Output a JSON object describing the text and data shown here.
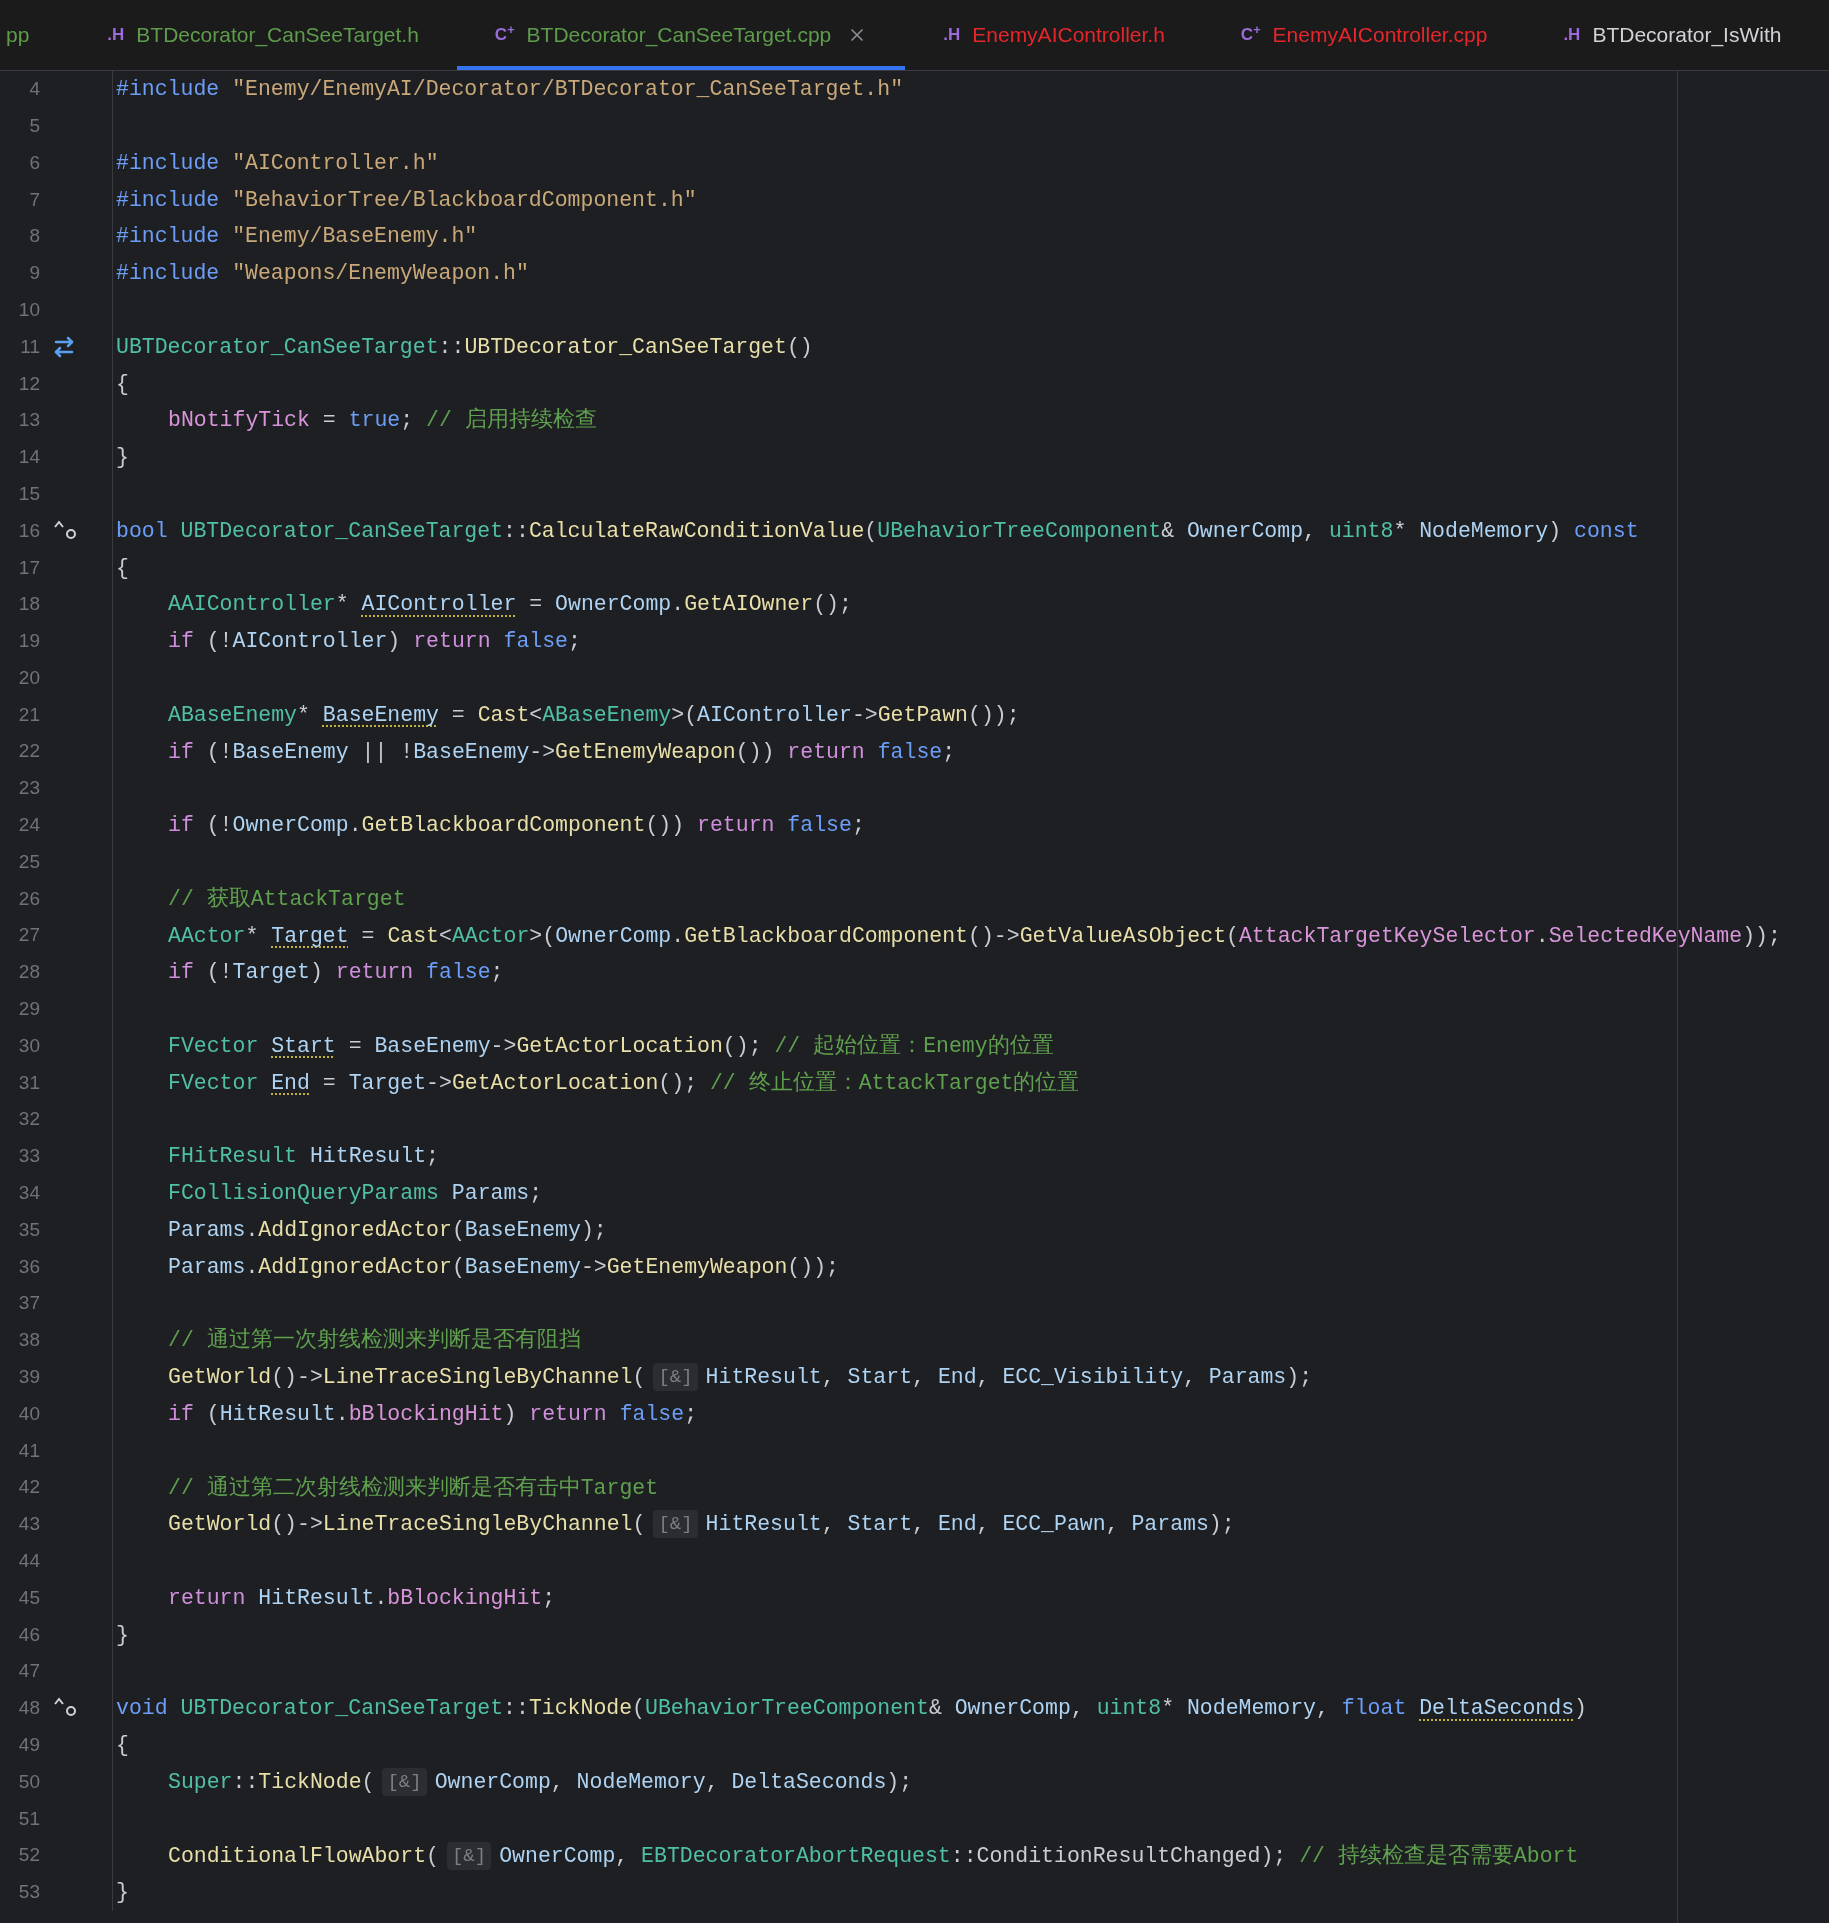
{
  "tabs": [
    {
      "label": "pp",
      "color": "#5e9c4c",
      "selected": false
    },
    {
      "label": "BTDecorator_CanSeeTarget.h",
      "icon": ".H",
      "color": "#5e9c4c",
      "selected": false
    },
    {
      "label": "BTDecorator_CanSeeTarget.cpp",
      "icon": "C$^{+}$",
      "color": "#5e9c4c",
      "selected": true
    },
    {
      "label": "EnemyAIController.h",
      "icon": ".H",
      "color": "#e5262b",
      "selected": false
    },
    {
      "label": "EnemyAIController.cpp",
      "icon": "C$^{+}$",
      "color": "#e5262b",
      "selected": false
    },
    {
      "label": "BTDecorator_IsWith",
      "icon": ".H",
      "color": "#d0d2d6",
      "selected": false
    }
  ],
  "lines": [
    {
      "number": "4",
      "tokens": [
        {
          "text": "#include ",
          "kind": "kw"
        },
        {
          "text": "\"Enemy/EnemyAI/Decorator/BTDecorator_CanSeeTarget.h\"",
          "kind": "str"
        }
      ]
    },
    {
      "number": "5"
    },
    {
      "number": "6",
      "tokens": [
        {
          "text": "#include ",
          "kind": "kw"
        },
        {
          "text": "\"AIController.h\"",
          "kind": "str"
        }
      ]
    },
    {
      "number": "7",
      "tokens": [
        {
          "text": "#include ",
          "kind": "kw"
        },
        {
          "text": "\"BehaviorTree/BlackboardComponent.h\"",
          "kind": "str"
        }
      ]
    },
    {
      "number": "8",
      "tokens": [
        {
          "text": "#include ",
          "kind": "kw"
        },
        {
          "text": "\"Enemy/BaseEnemy.h\"",
          "kind": "str"
        }
      ]
    },
    {
      "number": "9",
      "tokens": [
        {
          "text": "#include ",
          "kind": "kw"
        },
        {
          "text": "\"Weapons/EnemyWeapon.h\"",
          "kind": "str"
        }
      ]
    },
    {
      "number": "10"
    },
    {
      "number": "11",
      "kind": "swap",
      "tokens": [
        {
          "text": "UBTDecorator_CanSeeTarget",
          "kind": "type"
        },
        {
          "text": "::",
          "kind": "p"
        },
        {
          "text": "UBTDecorator_CanSeeTarget",
          "kind": "fn"
        },
        {
          "text": "()",
          "kind": "p"
        }
      ]
    },
    {
      "number": "12",
      "tokens": [
        {
          "text": "{",
          "kind": "p"
        }
      ]
    },
    {
      "number": "13",
      "indented": true,
      "tokens": [
        {
          "text": "bNotifyTick",
          "kind": "field"
        },
        {
          "text": " = ",
          "kind": "p"
        },
        {
          "text": "true",
          "kind": "kw"
        },
        {
          "text": "; ",
          "kind": "p"
        },
        {
          "text": "// 启用持续检查",
          "kind": "cmt"
        }
      ]
    },
    {
      "number": "14",
      "tokens": [
        {
          "text": "}",
          "kind": "p"
        }
      ]
    },
    {
      "number": "15"
    },
    {
      "number": "16",
      "kind": "override",
      "tokens": [
        {
          "text": "bool ",
          "kind": "kw"
        },
        {
          "text": "UBTDecorator_CanSeeTarget",
          "kind": "type"
        },
        {
          "text": "::",
          "kind": "p"
        },
        {
          "text": "CalculateRawConditionValue",
          "kind": "fn"
        },
        {
          "text": "(",
          "kind": "p"
        },
        {
          "text": "UBehaviorTreeComponent",
          "kind": "type"
        },
        {
          "text": "& ",
          "kind": "p"
        },
        {
          "text": "OwnerComp",
          "kind": "var"
        },
        {
          "text": ", ",
          "kind": "p"
        },
        {
          "text": "uint8",
          "kind": "type"
        },
        {
          "text": "* ",
          "kind": "p"
        },
        {
          "text": "NodeMemory",
          "kind": "var"
        },
        {
          "text": ") ",
          "kind": "p"
        },
        {
          "text": "const",
          "kind": "kw"
        }
      ]
    },
    {
      "number": "17",
      "tokens": [
        {
          "text": "{",
          "kind": "p"
        }
      ]
    },
    {
      "number": "18",
      "indented": true,
      "tokens": [
        {
          "text": "AAIController",
          "kind": "type"
        },
        {
          "text": "* ",
          "kind": "p"
        },
        {
          "text": "AIController",
          "kind": "var",
          "warned": true
        },
        {
          "text": " = ",
          "kind": "p"
        },
        {
          "text": "OwnerComp",
          "kind": "var"
        },
        {
          "text": ".",
          "kind": "p"
        },
        {
          "text": "GetAIOwner",
          "kind": "fn"
        },
        {
          "text": "();",
          "kind": "p"
        }
      ]
    },
    {
      "number": "19",
      "indented": true,
      "tokens": [
        {
          "text": "if ",
          "kind": "ctrl"
        },
        {
          "text": "(!",
          "kind": "p"
        },
        {
          "text": "AIController",
          "kind": "var"
        },
        {
          "text": ") ",
          "kind": "p"
        },
        {
          "text": "return ",
          "kind": "ctrl"
        },
        {
          "text": "false",
          "kind": "kw"
        },
        {
          "text": ";",
          "kind": "p"
        }
      ]
    },
    {
      "number": "20"
    },
    {
      "number": "21",
      "indented": true,
      "tokens": [
        {
          "text": "ABaseEnemy",
          "kind": "type"
        },
        {
          "text": "* ",
          "kind": "p"
        },
        {
          "text": "BaseEnemy",
          "kind": "var",
          "warned": true
        },
        {
          "text": " = ",
          "kind": "p"
        },
        {
          "text": "Cast",
          "kind": "fn"
        },
        {
          "text": "<",
          "kind": "p"
        },
        {
          "text": "ABaseEnemy",
          "kind": "type"
        },
        {
          "text": ">(",
          "kind": "p"
        },
        {
          "text": "AIController",
          "kind": "var"
        },
        {
          "text": "->",
          "kind": "p"
        },
        {
          "text": "GetPawn",
          "kind": "fn"
        },
        {
          "text": "());",
          "kind": "p"
        }
      ]
    },
    {
      "number": "22",
      "indented": true,
      "tokens": [
        {
          "text": "if ",
          "kind": "ctrl"
        },
        {
          "text": "(!",
          "kind": "p"
        },
        {
          "text": "BaseEnemy",
          "kind": "var"
        },
        {
          "text": " || !",
          "kind": "p"
        },
        {
          "text": "BaseEnemy",
          "kind": "var"
        },
        {
          "text": "->",
          "kind": "p"
        },
        {
          "text": "GetEnemyWeapon",
          "kind": "fn"
        },
        {
          "text": "()) ",
          "kind": "p"
        },
        {
          "text": "return ",
          "kind": "ctrl"
        },
        {
          "text": "false",
          "kind": "kw"
        },
        {
          "text": ";",
          "kind": "p"
        }
      ]
    },
    {
      "number": "23"
    },
    {
      "number": "24",
      "indented": true,
      "tokens": [
        {
          "text": "if ",
          "kind": "ctrl"
        },
        {
          "text": "(!",
          "kind": "p"
        },
        {
          "text": "OwnerComp",
          "kind": "var"
        },
        {
          "text": ".",
          "kind": "p"
        },
        {
          "text": "GetBlackboardComponent",
          "kind": "fn"
        },
        {
          "text": "()) ",
          "kind": "p"
        },
        {
          "text": "return ",
          "kind": "ctrl"
        },
        {
          "text": "false",
          "kind": "kw"
        },
        {
          "text": ";",
          "kind": "p"
        }
      ]
    },
    {
      "number": "25"
    },
    {
      "number": "26",
      "indented": true,
      "tokens": [
        {
          "text": "// 获取AttackTarget",
          "kind": "cmt"
        }
      ]
    },
    {
      "number": "27",
      "indented": true,
      "tokens": [
        {
          "text": "AActor",
          "kind": "type"
        },
        {
          "text": "* ",
          "kind": "p"
        },
        {
          "text": "Target",
          "kind": "var",
          "warned": true
        },
        {
          "text": " = ",
          "kind": "p"
        },
        {
          "text": "Cast",
          "kind": "fn"
        },
        {
          "text": "<",
          "kind": "p"
        },
        {
          "text": "AActor",
          "kind": "type"
        },
        {
          "text": ">(",
          "kind": "p"
        },
        {
          "text": "OwnerComp",
          "kind": "var"
        },
        {
          "text": ".",
          "kind": "p"
        },
        {
          "text": "GetBlackboardComponent",
          "kind": "fn"
        },
        {
          "text": "()->",
          "kind": "p"
        },
        {
          "text": "GetValueAsObject",
          "kind": "fn"
        },
        {
          "text": "(",
          "kind": "p"
        },
        {
          "text": "AttackTargetKeySelector",
          "kind": "field"
        },
        {
          "text": ".",
          "kind": "p"
        },
        {
          "text": "SelectedKeyName",
          "kind": "field"
        },
        {
          "text": "));",
          "kind": "p"
        }
      ]
    },
    {
      "number": "28",
      "indented": true,
      "tokens": [
        {
          "text": "if ",
          "kind": "ctrl"
        },
        {
          "text": "(!",
          "kind": "p"
        },
        {
          "text": "Target",
          "kind": "var"
        },
        {
          "text": ") ",
          "kind": "p"
        },
        {
          "text": "return ",
          "kind": "ctrl"
        },
        {
          "text": "false",
          "kind": "kw"
        },
        {
          "text": ";",
          "kind": "p"
        }
      ]
    },
    {
      "number": "29"
    },
    {
      "number": "30",
      "indented": true,
      "tokens": [
        {
          "text": "FVector ",
          "kind": "type"
        },
        {
          "text": "Start",
          "kind": "var",
          "warned": true
        },
        {
          "text": " = ",
          "kind": "p"
        },
        {
          "text": "BaseEnemy",
          "kind": "var"
        },
        {
          "text": "->",
          "kind": "p"
        },
        {
          "text": "GetActorLocation",
          "kind": "fn"
        },
        {
          "text": "(); ",
          "kind": "p"
        },
        {
          "text": "// 起始位置：Enemy的位置",
          "kind": "cmt"
        }
      ]
    },
    {
      "number": "31",
      "indented": true,
      "tokens": [
        {
          "text": "FVector ",
          "kind": "type"
        },
        {
          "text": "End",
          "kind": "var",
          "warned": true
        },
        {
          "text": " = ",
          "kind": "p"
        },
        {
          "text": "Target",
          "kind": "var"
        },
        {
          "text": "->",
          "kind": "p"
        },
        {
          "text": "GetActorLocation",
          "kind": "fn"
        },
        {
          "text": "(); ",
          "kind": "p"
        },
        {
          "text": "// 终止位置：AttackTarget的位置",
          "kind": "cmt"
        }
      ]
    },
    {
      "number": "32"
    },
    {
      "number": "33",
      "indented": true,
      "tokens": [
        {
          "text": "FHitResult ",
          "kind": "type"
        },
        {
          "text": "HitResult",
          "kind": "var"
        },
        {
          "text": ";",
          "kind": "p"
        }
      ]
    },
    {
      "number": "34",
      "indented": true,
      "tokens": [
        {
          "text": "FCollisionQueryParams ",
          "kind": "type"
        },
        {
          "text": "Params",
          "kind": "var"
        },
        {
          "text": ";",
          "kind": "p"
        }
      ]
    },
    {
      "number": "35",
      "indented": true,
      "tokens": [
        {
          "text": "Params",
          "kind": "var"
        },
        {
          "text": ".",
          "kind": "p"
        },
        {
          "text": "AddIgnoredActor",
          "kind": "fn"
        },
        {
          "text": "(",
          "kind": "p"
        },
        {
          "text": "BaseEnemy",
          "kind": "var"
        },
        {
          "text": ");",
          "kind": "p"
        }
      ]
    },
    {
      "number": "36",
      "indented": true,
      "tokens": [
        {
          "text": "Params",
          "kind": "var"
        },
        {
          "text": ".",
          "kind": "p"
        },
        {
          "text": "AddIgnoredActor",
          "kind": "fn"
        },
        {
          "text": "(",
          "kind": "p"
        },
        {
          "text": "BaseEnemy",
          "kind": "var"
        },
        {
          "text": "->",
          "kind": "p"
        },
        {
          "text": "GetEnemyWeapon",
          "kind": "fn"
        },
        {
          "text": "());",
          "kind": "p"
        }
      ]
    },
    {
      "number": "37"
    },
    {
      "number": "38",
      "indented": true,
      "tokens": [
        {
          "text": "// 通过第一次射线检测来判断是否有阻挡",
          "kind": "cmt"
        }
      ]
    },
    {
      "number": "39",
      "indented": true,
      "tokens": [
        {
          "text": "GetWorld",
          "kind": "fn"
        },
        {
          "text": "()->",
          "kind": "p"
        },
        {
          "text": "LineTraceSingleByChannel",
          "kind": "fn"
        },
        {
          "text": "(",
          "kind": "p"
        },
        {
          "text": "[&]",
          "kind": "hint"
        },
        {
          "text": "HitResult",
          "kind": "var"
        },
        {
          "text": ", ",
          "kind": "p"
        },
        {
          "text": "Start",
          "kind": "var"
        },
        {
          "text": ", ",
          "kind": "p"
        },
        {
          "text": "End",
          "kind": "var"
        },
        {
          "text": ", ",
          "kind": "p"
        },
        {
          "text": "ECC_Visibility",
          "kind": "var"
        },
        {
          "text": ", ",
          "kind": "p"
        },
        {
          "text": "Params",
          "kind": "var"
        },
        {
          "text": ");",
          "kind": "p"
        }
      ]
    },
    {
      "number": "40",
      "indented": true,
      "tokens": [
        {
          "text": "if ",
          "kind": "ctrl"
        },
        {
          "text": "(",
          "kind": "p"
        },
        {
          "text": "HitResult",
          "kind": "var"
        },
        {
          "text": ".",
          "kind": "p"
        },
        {
          "text": "bBlockingHit",
          "kind": "field"
        },
        {
          "text": ") ",
          "kind": "p"
        },
        {
          "text": "return ",
          "kind": "ctrl"
        },
        {
          "text": "false",
          "kind": "kw"
        },
        {
          "text": ";",
          "kind": "p"
        }
      ]
    },
    {
      "number": "41"
    },
    {
      "number": "42",
      "indented": true,
      "tokens": [
        {
          "text": "// 通过第二次射线检测来判断是否有击中Target",
          "kind": "cmt"
        }
      ]
    },
    {
      "number": "43",
      "indented": true,
      "tokens": [
        {
          "text": "GetWorld",
          "kind": "fn"
        },
        {
          "text": "()->",
          "kind": "p"
        },
        {
          "text": "LineTraceSingleByChannel",
          "kind": "fn"
        },
        {
          "text": "(",
          "kind": "p"
        },
        {
          "text": "[&]",
          "kind": "hint"
        },
        {
          "text": "HitResult",
          "kind": "var"
        },
        {
          "text": ", ",
          "kind": "p"
        },
        {
          "text": "Start",
          "kind": "var"
        },
        {
          "text": ", ",
          "kind": "p"
        },
        {
          "text": "End",
          "kind": "var"
        },
        {
          "text": ", ",
          "kind": "p"
        },
        {
          "text": "ECC_Pawn",
          "kind": "var"
        },
        {
          "text": ", ",
          "kind": "p"
        },
        {
          "text": "Params",
          "kind": "var"
        },
        {
          "text": ");",
          "kind": "p"
        }
      ]
    },
    {
      "number": "44"
    },
    {
      "number": "45",
      "indented": true,
      "tokens": [
        {
          "text": "return ",
          "kind": "ctrl"
        },
        {
          "text": "HitResult",
          "kind": "var"
        },
        {
          "text": ".",
          "kind": "p"
        },
        {
          "text": "bBlockingHit",
          "kind": "field"
        },
        {
          "text": ";",
          "kind": "p"
        }
      ]
    },
    {
      "number": "46",
      "tokens": [
        {
          "text": "}",
          "kind": "p"
        }
      ]
    },
    {
      "number": "47"
    },
    {
      "number": "48",
      "kind": "override",
      "tokens": [
        {
          "text": "void ",
          "kind": "kw"
        },
        {
          "text": "UBTDecorator_CanSeeTarget",
          "kind": "type"
        },
        {
          "text": "::",
          "kind": "p"
        },
        {
          "text": "TickNode",
          "kind": "fn"
        },
        {
          "text": "(",
          "kind": "p"
        },
        {
          "text": "UBehaviorTreeComponent",
          "kind": "type"
        },
        {
          "text": "& ",
          "kind": "p"
        },
        {
          "text": "OwnerComp",
          "kind": "var"
        },
        {
          "text": ", ",
          "kind": "p"
        },
        {
          "text": "uint8",
          "kind": "type"
        },
        {
          "text": "* ",
          "kind": "p"
        },
        {
          "text": "NodeMemory",
          "kind": "var"
        },
        {
          "text": ", ",
          "kind": "p"
        },
        {
          "text": "float ",
          "kind": "kw"
        },
        {
          "text": "DeltaSeconds",
          "kind": "var",
          "warned": true
        },
        {
          "text": ")",
          "kind": "p"
        }
      ]
    },
    {
      "number": "49",
      "tokens": [
        {
          "text": "{",
          "kind": "p"
        }
      ]
    },
    {
      "number": "50",
      "indented": true,
      "tokens": [
        {
          "text": "Super",
          "kind": "type"
        },
        {
          "text": "::",
          "kind": "p"
        },
        {
          "text": "TickNode",
          "kind": "fn"
        },
        {
          "text": "(",
          "kind": "p"
        },
        {
          "text": "[&]",
          "kind": "hint"
        },
        {
          "text": "OwnerComp",
          "kind": "var"
        },
        {
          "text": ", ",
          "kind": "p"
        },
        {
          "text": "NodeMemory",
          "kind": "var"
        },
        {
          "text": ", ",
          "kind": "p"
        },
        {
          "text": "DeltaSeconds",
          "kind": "var"
        },
        {
          "text": ");",
          "kind": "p"
        }
      ]
    },
    {
      "number": "51"
    },
    {
      "number": "52",
      "indented": true,
      "tokens": [
        {
          "text": "ConditionalFlowAbort",
          "kind": "fn"
        },
        {
          "text": "(",
          "kind": "p"
        },
        {
          "text": "[&]",
          "kind": "hint"
        },
        {
          "text": "OwnerComp",
          "kind": "var"
        },
        {
          "text": ", ",
          "kind": "p"
        },
        {
          "text": "EBTDecoratorAbortRequest",
          "kind": "type"
        },
        {
          "text": "::ConditionResultChanged); ",
          "kind": "p"
        },
        {
          "text": "// 持续检查是否需要Abort",
          "kind": "cmt"
        }
      ]
    },
    {
      "number": "53",
      "tokens": [
        {
          "text": "}",
          "kind": "p"
        }
      ]
    }
  ]
}
